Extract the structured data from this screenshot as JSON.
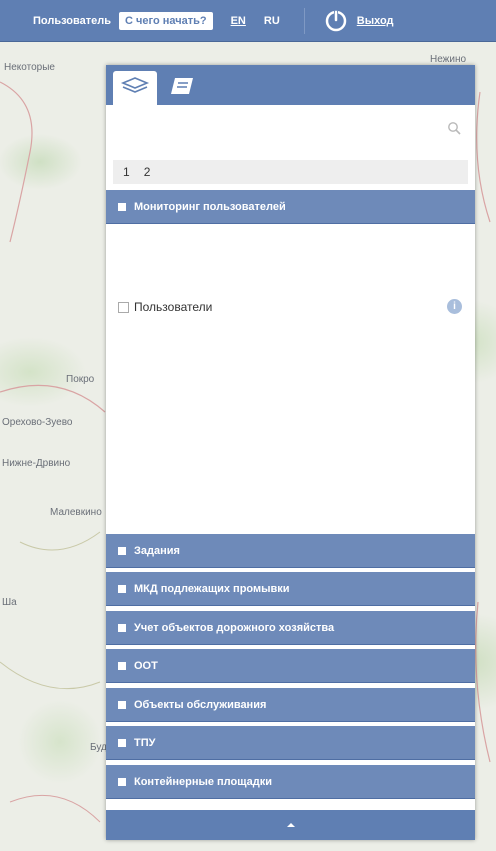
{
  "topbar": {
    "user_label": "Пользователь",
    "help_button": "С чего начать?",
    "lang_en": "EN",
    "lang_ru": "RU",
    "exit_label": "Выход",
    "power_icon": "power-icon"
  },
  "panel": {
    "tabs": [
      {
        "icon": "layers-icon",
        "active": true
      },
      {
        "icon": "book-icon",
        "active": false
      }
    ],
    "search": {
      "placeholder": "",
      "value": ""
    },
    "pages": [
      "1",
      "2"
    ],
    "open_section": {
      "label": "Мониторинг пользователей",
      "items": [
        {
          "label": "Пользователи",
          "checked": false,
          "info_icon": "info-icon"
        }
      ]
    },
    "sections": [
      {
        "label": "Задания"
      },
      {
        "label": "МКД подлежащих промывки"
      },
      {
        "label": "Учет объектов дорожного хозяйства"
      },
      {
        "label": "ООТ"
      },
      {
        "label": "Объекты обслуживания"
      },
      {
        "label": "ТПУ"
      },
      {
        "label": "Контейнерные площадки"
      }
    ]
  },
  "map": {
    "labels": [
      "Некоторые",
      "Покро",
      "Орехово-Зуево",
      "Нижне-Дрвино",
      "Малевкино",
      "Нежино",
      "Ша",
      "Будо"
    ]
  },
  "colors": {
    "accent": "#5f7fb3",
    "section": "#6e8ab9"
  }
}
